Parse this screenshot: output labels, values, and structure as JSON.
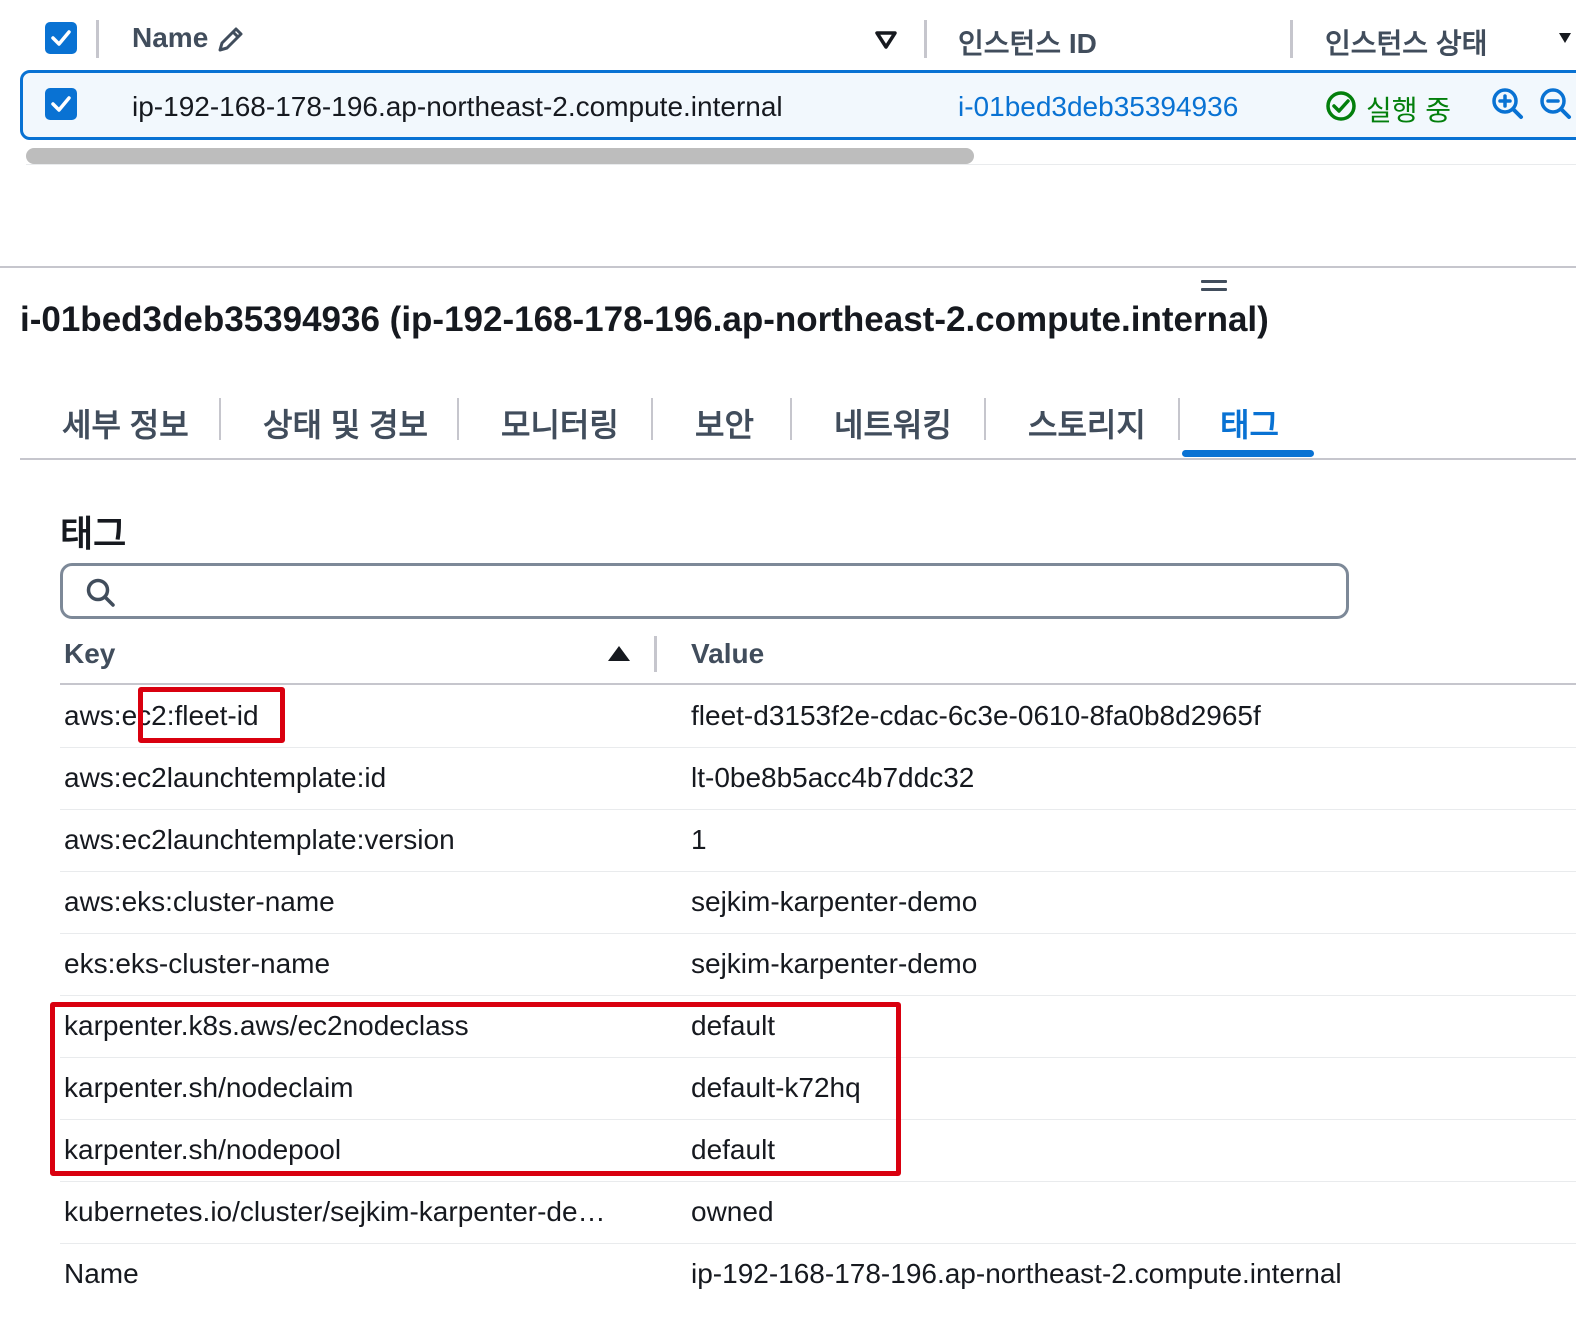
{
  "instance_table": {
    "columns": {
      "name": "Name",
      "instance_id": "인스턴스 ID",
      "instance_state": "인스턴스 상태"
    },
    "row": {
      "name": "ip-192-168-178-196.ap-northeast-2.compute.internal",
      "instance_id": "i-01bed3deb35394936",
      "state": "실행 중"
    }
  },
  "detail": {
    "title": "i-01bed3deb35394936 (ip-192-168-178-196.ap-northeast-2.compute.internal)",
    "tabs": [
      {
        "label": "세부 정보"
      },
      {
        "label": "상태 및 경보"
      },
      {
        "label": "모니터링"
      },
      {
        "label": "보안"
      },
      {
        "label": "네트워킹"
      },
      {
        "label": "스토리지"
      },
      {
        "label": "태그",
        "active": true
      }
    ]
  },
  "tags": {
    "title": "태그",
    "search_placeholder": "",
    "columns": {
      "key": "Key",
      "value": "Value"
    },
    "rows": [
      {
        "key": "aws:ec2:fleet-id",
        "value": "fleet-d3153f2e-cdac-6c3e-0610-8fa0b8d2965f"
      },
      {
        "key": "aws:ec2launchtemplate:id",
        "value": "lt-0be8b5acc4b7ddc32"
      },
      {
        "key": "aws:ec2launchtemplate:version",
        "value": "1"
      },
      {
        "key": "aws:eks:cluster-name",
        "value": "sejkim-karpenter-demo"
      },
      {
        "key": "eks:eks-cluster-name",
        "value": "sejkim-karpenter-demo"
      },
      {
        "key": "karpenter.k8s.aws/ec2nodeclass",
        "value": "default"
      },
      {
        "key": "karpenter.sh/nodeclaim",
        "value": "default-k72hq"
      },
      {
        "key": "karpenter.sh/nodepool",
        "value": "default"
      },
      {
        "key": "kubernetes.io/cluster/sejkim-karpenter-de…",
        "value": "owned"
      },
      {
        "key": "Name",
        "value": "ip-192-168-178-196.ap-northeast-2.compute.internal"
      }
    ]
  },
  "colors": {
    "accent": "#0972d3",
    "success": "#037f0c",
    "annotation": "#d9000f"
  }
}
